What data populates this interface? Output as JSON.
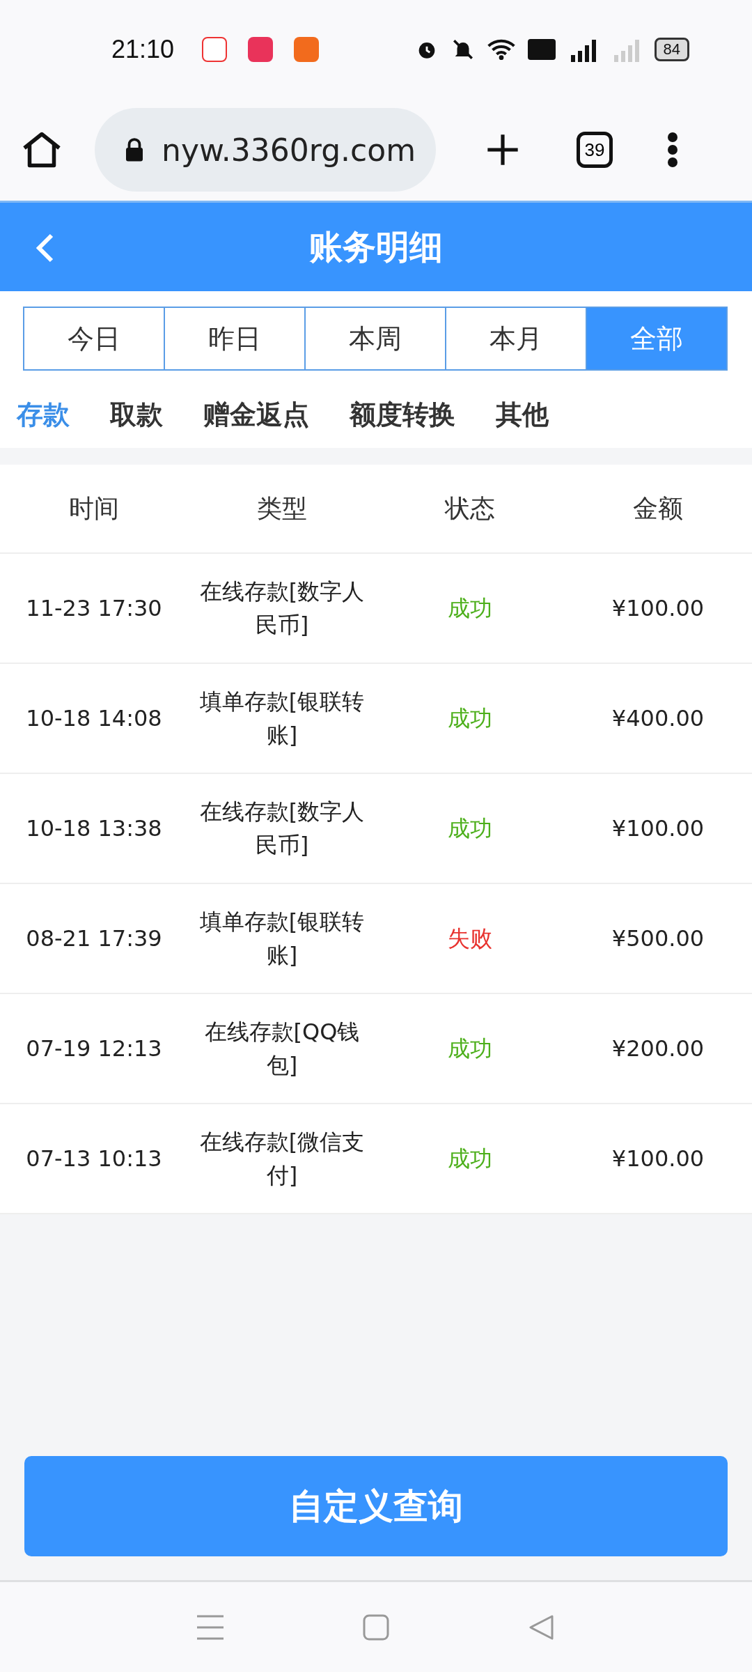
{
  "status_bar": {
    "time": "21:10",
    "battery": "84"
  },
  "browser": {
    "url": "nyw.3360rg.com",
    "tab_count": "39"
  },
  "header": {
    "title": "账务明细"
  },
  "period_tabs": [
    {
      "label": "今日",
      "selected": false
    },
    {
      "label": "昨日",
      "selected": false
    },
    {
      "label": "本周",
      "selected": false
    },
    {
      "label": "本月",
      "selected": false
    },
    {
      "label": "全部",
      "selected": true
    }
  ],
  "category_tabs": [
    {
      "label": "存款",
      "selected": true
    },
    {
      "label": "取款",
      "selected": false
    },
    {
      "label": "赠金返点",
      "selected": false
    },
    {
      "label": "额度转换",
      "selected": false
    },
    {
      "label": "其他",
      "selected": false
    }
  ],
  "table": {
    "columns": [
      "时间",
      "类型",
      "状态",
      "金额"
    ],
    "rows": [
      {
        "time": "11-23 17:30",
        "type": "在线存款[数字人民币]",
        "status": {
          "text": "成功",
          "kind": "success"
        },
        "amount": "¥100.00"
      },
      {
        "time": "10-18 14:08",
        "type": "填单存款[银联转账]",
        "status": {
          "text": "成功",
          "kind": "success"
        },
        "amount": "¥400.00"
      },
      {
        "time": "10-18 13:38",
        "type": "在线存款[数字人民币]",
        "status": {
          "text": "成功",
          "kind": "success"
        },
        "amount": "¥100.00"
      },
      {
        "time": "08-21 17:39",
        "type": "填单存款[银联转账]",
        "status": {
          "text": "失败",
          "kind": "fail"
        },
        "amount": "¥500.00"
      },
      {
        "time": "07-19 12:13",
        "type": "在线存款[QQ钱包]",
        "status": {
          "text": "成功",
          "kind": "success"
        },
        "amount": "¥200.00"
      },
      {
        "time": "07-13 10:13",
        "type": "在线存款[微信支付]",
        "status": {
          "text": "成功",
          "kind": "success"
        },
        "amount": "¥100.00"
      }
    ]
  },
  "query_button": {
    "label": "自定义查询"
  }
}
